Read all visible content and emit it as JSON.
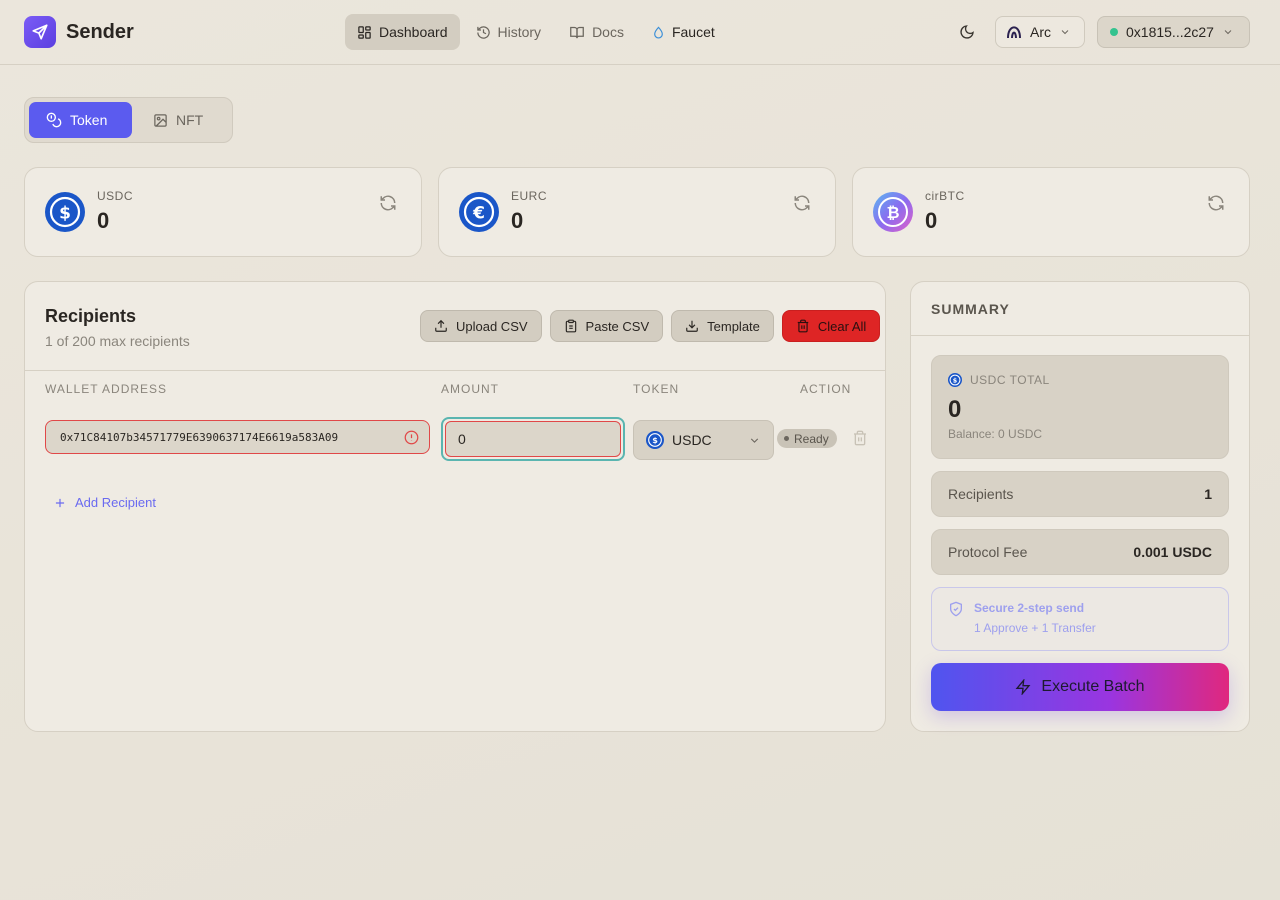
{
  "app": {
    "name": "Sender",
    "nav": [
      {
        "label": "Dashboard",
        "icon": "grid-icon",
        "active": true
      },
      {
        "label": "History",
        "icon": "history-icon"
      },
      {
        "label": "Docs",
        "icon": "book-icon"
      },
      {
        "label": "Faucet",
        "icon": "droplet-icon"
      }
    ],
    "network": "Arc",
    "wallet": "0x1815...2c27"
  },
  "asset_tabs": [
    {
      "label": "Token",
      "active": true
    },
    {
      "label": "NFT",
      "active": false
    }
  ],
  "balances": [
    {
      "symbol": "USDC",
      "amount": "0",
      "color": "#1a56c8"
    },
    {
      "symbol": "EURC",
      "amount": "0",
      "color": "#1a56c8"
    },
    {
      "symbol": "cirBTC",
      "amount": "0",
      "color": "#8a6cf0"
    }
  ],
  "recipients": {
    "title": "Recipients",
    "subtitle": "1 of 200 max recipients",
    "actions": {
      "upload": "Upload CSV",
      "paste": "Paste CSV",
      "template": "Template",
      "clear": "Clear All"
    },
    "columns": {
      "address": "WALLET ADDRESS",
      "amount": "AMOUNT",
      "token": "TOKEN",
      "action": "ACTION"
    },
    "rows": [
      {
        "address": "0x71C84107b34571779E6390637174E6619a583A09",
        "amount": "0",
        "token": "USDC",
        "status": "Ready"
      }
    ],
    "add_label": "Add Recipient"
  },
  "summary": {
    "title": "SUMMARY",
    "total_label": "USDC TOTAL",
    "total_value": "0",
    "balance_text": "Balance: 0 USDC",
    "recipients_label": "Recipients",
    "recipients_value": "1",
    "fee_label": "Protocol Fee",
    "fee_value": "0.001 USDC",
    "secure_title": "Secure 2-step send",
    "secure_sub": "1 Approve + 1 Transfer",
    "execute_label": "Execute Batch"
  }
}
